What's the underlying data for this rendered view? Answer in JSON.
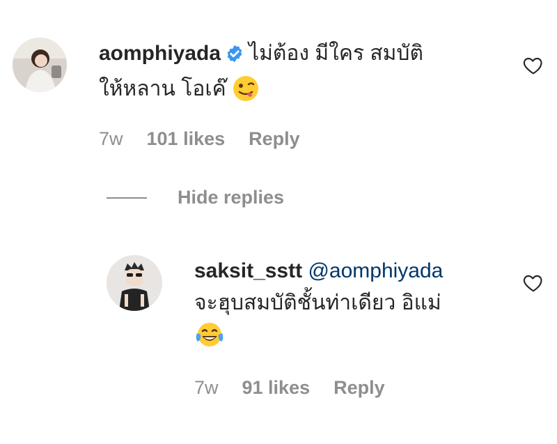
{
  "comments": [
    {
      "username": "aomphiyada",
      "verified": true,
      "text_line1": "ไม่ต้อง มีใคร สมบัติ",
      "text_line2": "ให้หลาน โอเค๊",
      "emoji": "winking-face-with-tongue",
      "time": "7w",
      "likes": "101 likes",
      "reply": "Reply"
    },
    {
      "username": "saksit_sstt",
      "mention": "@aomphiyada",
      "text_line1": "จะฮุบสมบัติชั้นท่าเดียว อิแม่",
      "emoji": "face-with-tears-of-joy",
      "time": "7w",
      "likes": "91 likes",
      "reply": "Reply"
    }
  ],
  "hide_replies_label": "Hide replies",
  "colors": {
    "text": "#262626",
    "meta": "#8e8e8e",
    "mention": "#00376b",
    "verified": "#3897f0"
  }
}
